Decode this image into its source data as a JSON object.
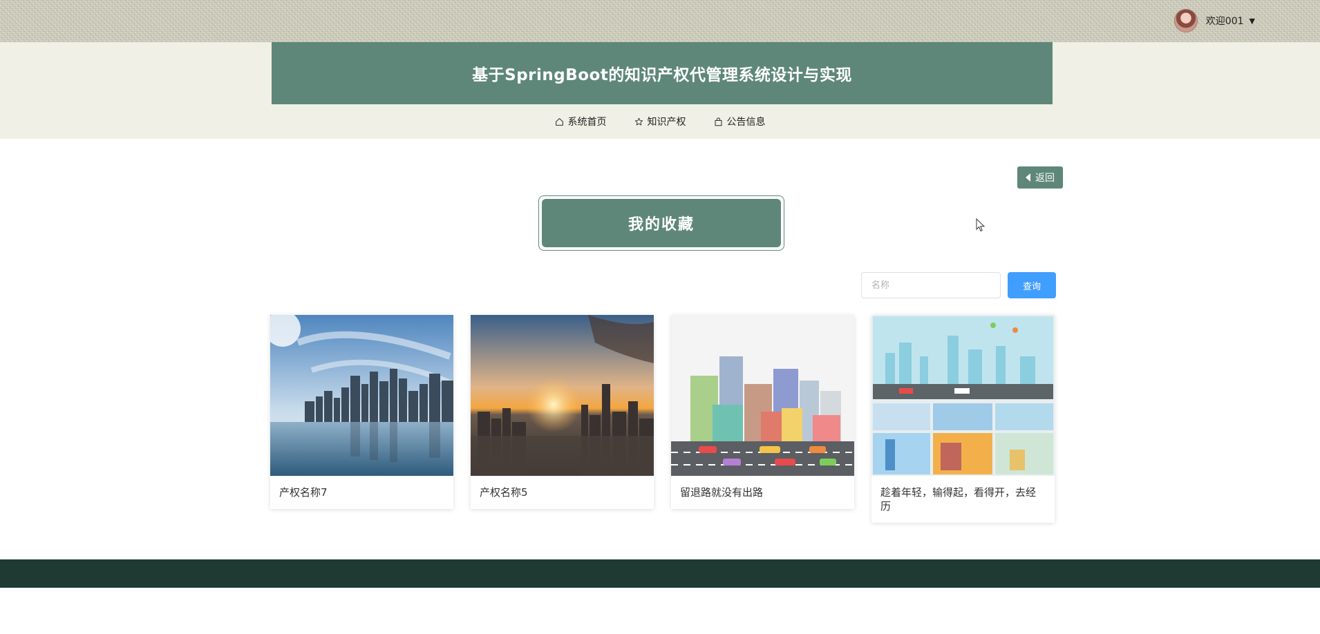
{
  "user": {
    "greeting": "欢迎001"
  },
  "header": {
    "title": "基于SpringBoot的知识产权代管理系统设计与实现"
  },
  "nav": [
    {
      "label": "系统首页",
      "icon": "home-icon"
    },
    {
      "label": "知识产权",
      "icon": "star-icon"
    },
    {
      "label": "公告信息",
      "icon": "bag-icon"
    }
  ],
  "back_button": {
    "label": "返回"
  },
  "section": {
    "title": "我的收藏"
  },
  "search": {
    "placeholder": "名称",
    "value": "",
    "button_label": "查询"
  },
  "cards": [
    {
      "name": "产权名称7",
      "image": "city-skyline-reflection"
    },
    {
      "name": "产权名称5",
      "image": "city-sunset-aerial"
    },
    {
      "name": "留退路就没有出路",
      "image": "cartoon-city-street"
    },
    {
      "name": "趁着年轻，输得起，看得开，去经历",
      "image": "cartoon-city-collage"
    }
  ],
  "colors": {
    "primary": "#5e877a",
    "accent": "#409eff",
    "footer": "#1f3a33",
    "band": "#f0f0e6"
  }
}
